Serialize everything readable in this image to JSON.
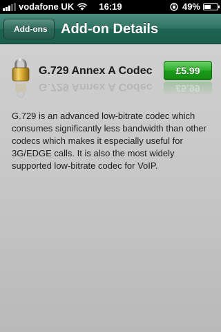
{
  "status_bar": {
    "carrier": "vodafone UK",
    "time": "16:19",
    "battery_percent": "49%",
    "battery_level": 0.49,
    "signal_bars_active": 3,
    "signal_bars_total": 5
  },
  "nav_bar": {
    "back_label": "Add-ons",
    "title": "Add-on Details",
    "color": "#2f7563"
  },
  "addon": {
    "icon": "padlock-icon",
    "name": "G.729 Annex A Codec",
    "price": "£5.99",
    "price_button_color": "#2fae2c",
    "description": "G.729 is an advanced low-bitrate codec which consumes significantly less bandwidth than other codecs which makes it especially useful for 3G/EDGE calls. It is also the most widely supported low-bitrate codec for VoIP."
  }
}
